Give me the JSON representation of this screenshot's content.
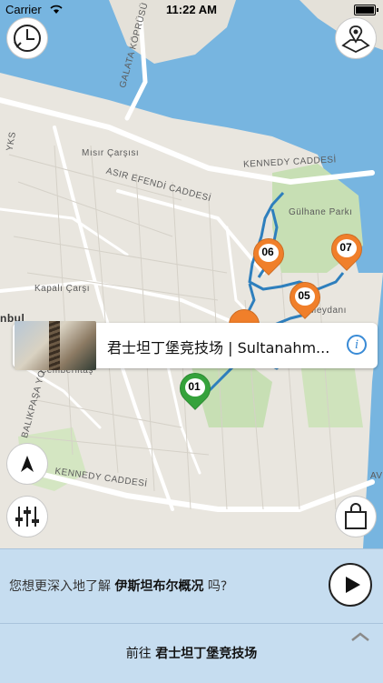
{
  "status_bar": {
    "carrier": "Carrier",
    "time": "11:22 AM"
  },
  "map": {
    "labels": {
      "kennedy_caddesi_top": "KENNEDY CADDESİ",
      "kennedy_caddesi_bottom": "KENNEDY CADDESİ",
      "galata_koprusu": "GALATA KÖPRÜSÜ",
      "misir_carsisi": "Mısır Çarşısı",
      "asir_efendi": "ASIR EFENDİ CADDESİ",
      "gulhane": "Gülhane Parkı",
      "kapali_carsi": "Kapalı Çarşı",
      "meydani": "Meydanı",
      "istanbul": "nbul",
      "yks": "YKS",
      "cemberlitas": "Çemberlitaş",
      "balikpasa": "BALIKPAŞA YOKUŞU",
      "av": "AV"
    },
    "pins": [
      {
        "num": "01",
        "color": "green"
      },
      {
        "num": "05",
        "color": "orange"
      },
      {
        "num": "06",
        "color": "orange"
      },
      {
        "num": "07",
        "color": "orange"
      }
    ]
  },
  "card": {
    "title": "君士坦丁堡竞技场 | Sultanahm..."
  },
  "panel": {
    "prompt_prefix": "您想更深入地了解",
    "prompt_topic": "伊斯坦布尔概况",
    "prompt_suffix": "吗?"
  },
  "navigate": {
    "prefix": "前往",
    "destination": "君士坦丁堡竞技场"
  },
  "colors": {
    "route": "#2e7fbd",
    "pin_orange": "#f07f2a",
    "pin_green": "#35a23b",
    "panel_bg": "#c6ddf0"
  }
}
